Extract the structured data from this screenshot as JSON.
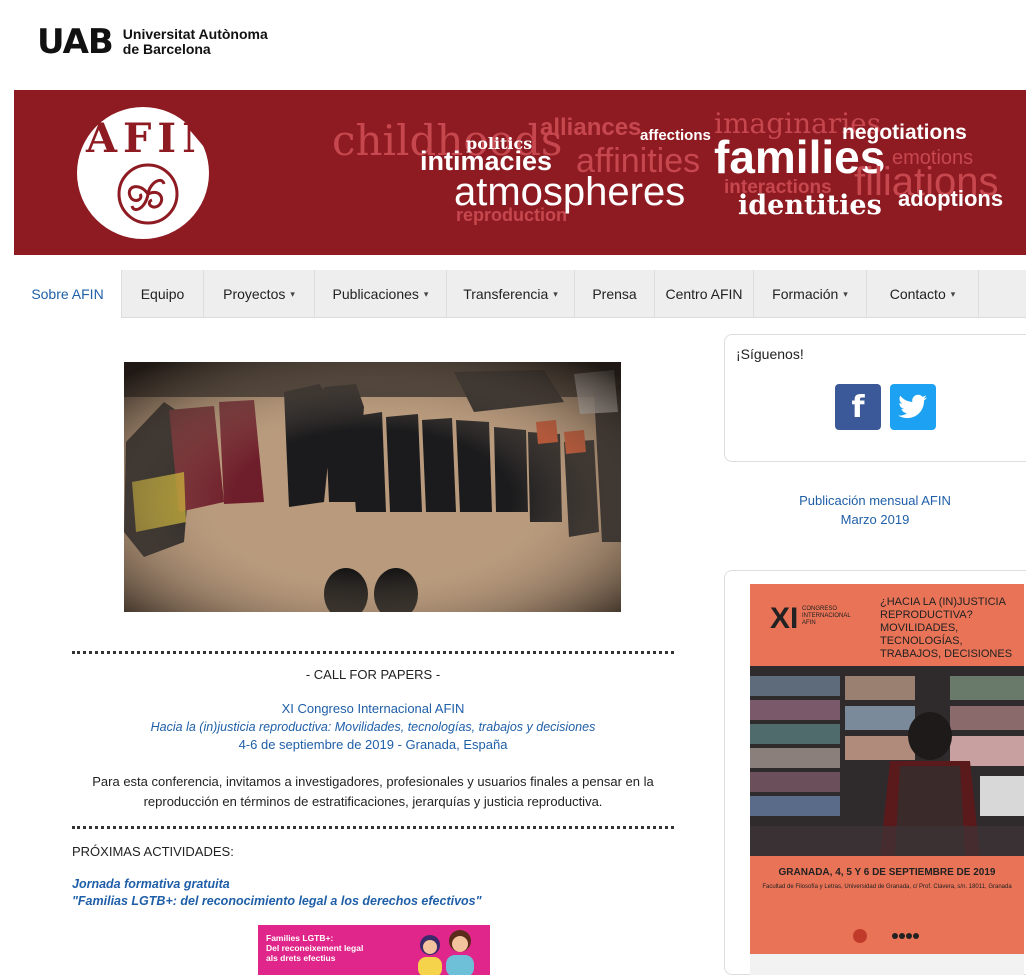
{
  "header": {
    "logo_text": "UAB",
    "university_line1": "Universitat Autònoma",
    "university_line2": "de Barcelona"
  },
  "banner": {
    "logo": "AFIN",
    "words": [
      "childhoods",
      "politics",
      "alliances",
      "affections",
      "imaginaries",
      "negotiations",
      "intimacies",
      "affinities",
      "families",
      "emotions",
      "atmospheres",
      "interactions",
      "filiations",
      "reproduction",
      "identities",
      "adoptions"
    ],
    "colors": {
      "background": "#8e1b22",
      "white": "#ffffff",
      "faded": "#c7474e"
    }
  },
  "nav": {
    "items": [
      {
        "label": "Sobre AFIN",
        "caret": false,
        "active": true
      },
      {
        "label": "Equipo",
        "caret": false,
        "active": false
      },
      {
        "label": "Proyectos",
        "caret": true,
        "active": false
      },
      {
        "label": "Publicaciones",
        "caret": true,
        "active": false
      },
      {
        "label": "Transferencia",
        "caret": true,
        "active": false
      },
      {
        "label": "Prensa",
        "caret": false,
        "active": false
      },
      {
        "label": "Centro AFIN",
        "caret": false,
        "active": false
      },
      {
        "label": "Formación",
        "caret": true,
        "active": false
      },
      {
        "label": "Contacto",
        "caret": true,
        "active": false
      }
    ],
    "caret_glyph": "▾"
  },
  "main": {
    "call_for_papers": "- CALL FOR PAPERS -",
    "congress_title": "XI Congreso Internacional AFIN",
    "congress_subtitle": "Hacia la (in)justicia reproductiva: Movilidades, tecnologías, trabajos y decisiones",
    "congress_dates": "4-6 de septiembre de 2019 - Granada, España",
    "conference_text_1": "Para esta conferencia, invitamos a investigadores, profesionales y usuarios finales a pensar en la",
    "conference_text_2": "reproducción en términos de estratificaciones, jerarquías y justicia reproductiva.",
    "proximas": "PRÓXIMAS ACTIVIDADES:",
    "jornada_1": "Jornada formativa gratuita",
    "jornada_2": "\"Familias LGTB+: del reconocimiento legal a los derechos efectivos\"",
    "pink_card": {
      "line1": "Families LGTB+:",
      "line2": "Del reconeixement legal",
      "line3": "als drets efectius"
    }
  },
  "sidebar": {
    "follow": "¡Síguenos!",
    "facebook_glyph": "f",
    "pub_line1": "Publicación mensual AFIN",
    "pub_line2": "Marzo 2019",
    "poster": {
      "xi": "XI",
      "small1": "CONGRESO",
      "small2": "INTERNACIONAL",
      "small3": "AFIN",
      "title1": "¿HACIA LA (IN)JUSTICIA",
      "title2": "REPRODUCTIVA?",
      "title3": "MOVILIDADES,",
      "title4": "TECNOLOGÍAS,",
      "title5": "TRABAJOS, DECISIONES",
      "date": "GRANADA, 4, 5 Y 6 DE SEPTIEMBRE DE 2019",
      "faculty": "Facultad de Filosofía y Letras, Universidad de Granada, c/ Prof. Clavera, s/n. 18011, Granada"
    }
  },
  "colors": {
    "link_blue": "#1f5fa8",
    "facebook": "#3b5998",
    "twitter": "#1da1f2",
    "poster_bg": "#e97357",
    "pink": "#e0268a"
  }
}
